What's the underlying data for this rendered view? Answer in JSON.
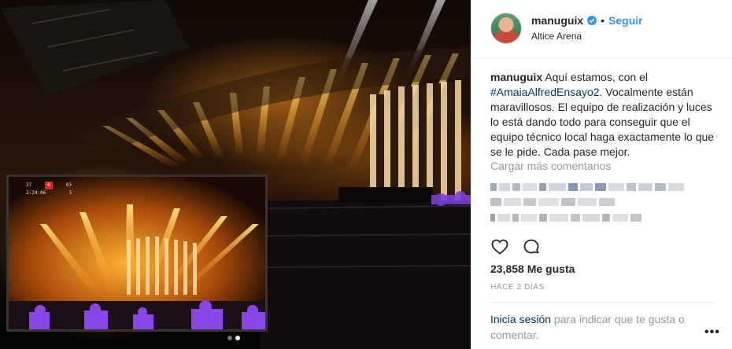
{
  "post": {
    "username": "manuguix",
    "follow_label": "Seguir",
    "bullet": "•",
    "location": "Altice Arena",
    "caption_user": "manuguix",
    "caption_before": " Aquí estamos, con el ",
    "caption_hashtag": "#AmaiaAlfredEnsayo2",
    "caption_after": ". Vocalmente están maravillosos. El equipo de realización y luces lo está dando todo para conseguir que el equipo técnico local haga exactamente lo que se le pide. Cada pase mejor.",
    "load_more_label": "Cargar más comentarios",
    "likes": "23,858 Me gusta",
    "time_ago": "HACE 2 DÍAS",
    "login_link": "Inicia sesión",
    "login_rest": " para indicar que te gusta o comentar.",
    "more_options": "•••",
    "monitor_hud": {
      "left_top": "27",
      "red": "6",
      "right_top": "03",
      "left_bottom": "2:24:06",
      "right_bottom": "3"
    }
  },
  "icons": {
    "verified": "verified-badge-icon",
    "like": "heart-icon",
    "comment": "comment-bubble-icon"
  },
  "colors": {
    "link_blue": "#3897f0",
    "hashtag": "#003569",
    "muted": "#999999",
    "text": "#262626"
  },
  "carousel": {
    "total": 2,
    "active": 1
  }
}
